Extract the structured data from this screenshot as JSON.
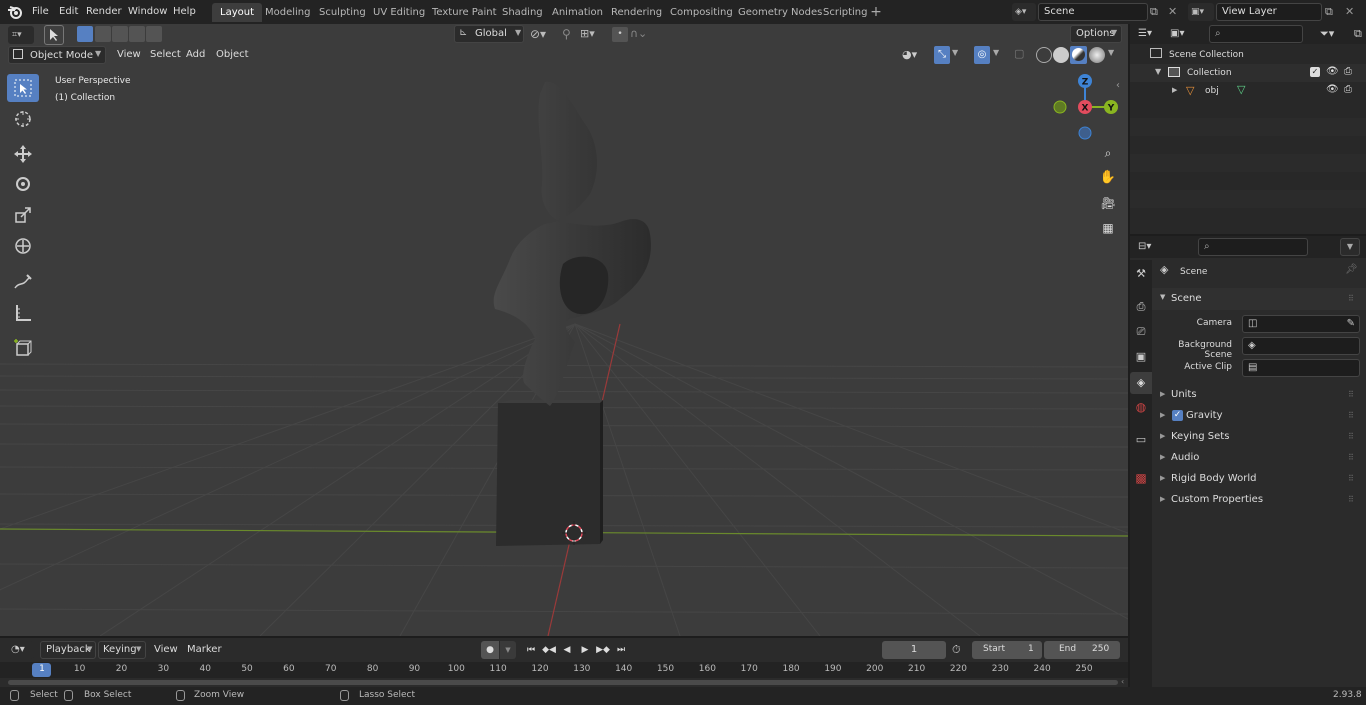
{
  "topbar": {
    "menus": [
      "File",
      "Edit",
      "Render",
      "Window",
      "Help"
    ],
    "workspaces": [
      "Layout",
      "Modeling",
      "Sculpting",
      "UV Editing",
      "Texture Paint",
      "Shading",
      "Animation",
      "Rendering",
      "Compositing",
      "Geometry Nodes",
      "Scripting"
    ],
    "active_workspace": "Layout",
    "scene_name": "Scene",
    "view_layer": "View Layer"
  },
  "tool_header": {
    "orientation": "Global",
    "options_label": "Options"
  },
  "viewport_header": {
    "mode": "Object Mode",
    "menus": [
      "View",
      "Select",
      "Add",
      "Object"
    ]
  },
  "viewport": {
    "perspective_label": "User Perspective",
    "collection_label": "(1) Collection",
    "gizmo_axes": {
      "x": "X",
      "y": "Y",
      "z": "Z"
    }
  },
  "outliner": {
    "scene_collection": "Scene Collection",
    "collection": "Collection",
    "object": "obj"
  },
  "properties": {
    "context_title": "Scene",
    "panel_title": "Scene",
    "fields": [
      {
        "label": "Camera",
        "value": ""
      },
      {
        "label": "Background Scene",
        "value": ""
      },
      {
        "label": "Active Clip",
        "value": ""
      }
    ],
    "sections": [
      "Units",
      "Gravity",
      "Keying Sets",
      "Audio",
      "Rigid Body World",
      "Custom Properties"
    ],
    "gravity_enabled": true
  },
  "timeline": {
    "menus": [
      "Playback",
      "Keying",
      "View",
      "Marker"
    ],
    "current_frame": "1",
    "start_label": "Start",
    "start_value": "1",
    "end_label": "End",
    "end_value": "250",
    "ruler": [
      "1",
      "10",
      "20",
      "30",
      "40",
      "50",
      "60",
      "70",
      "80",
      "90",
      "100",
      "110",
      "120",
      "130",
      "140",
      "150",
      "160",
      "170",
      "180",
      "190",
      "200",
      "210",
      "220",
      "230",
      "240",
      "250"
    ]
  },
  "statusbar": {
    "items": [
      "Select",
      "Box Select",
      "Zoom View",
      "Lasso Select"
    ],
    "version": "2.93.8"
  },
  "colors": {
    "accent": "#5680c2",
    "x_axis": "#e34c5e",
    "y_axis": "#8ab521",
    "z_axis": "#3e84d6"
  }
}
